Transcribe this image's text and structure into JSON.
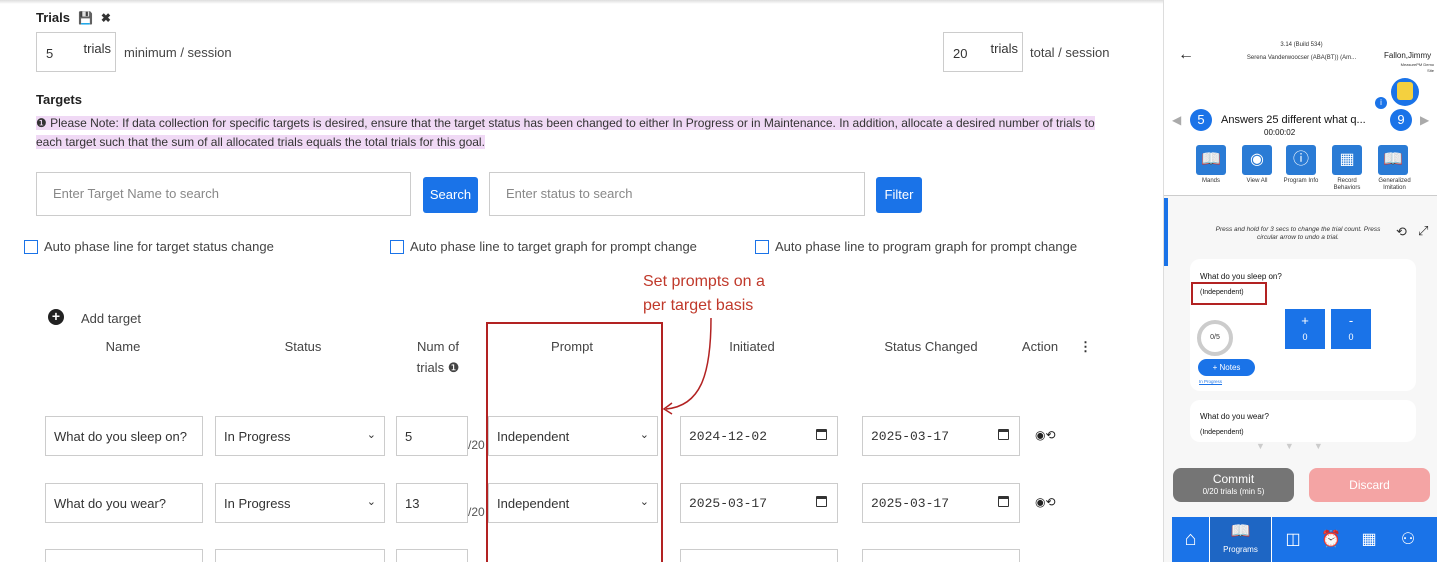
{
  "trials": {
    "title": "Trials",
    "save_icon": "save-icon",
    "close_icon": "close-icon",
    "min_value": "5",
    "min_unit": "trials",
    "min_label": "minimum / session",
    "total_value": "20",
    "total_unit": "trials",
    "total_label": "total / session"
  },
  "targets": {
    "heading": "Targets",
    "note": "Please Note: If data collection for specific targets is desired, ensure that the target status has been changed to either In Progress or in Maintenance. In addition, allocate a desired number of trials to each target such that the sum of all allocated trials equals the total trials for this goal.",
    "search_placeholder": "Enter Target Name to search",
    "search_label": "Search",
    "status_placeholder": "Enter status to search",
    "filter_label": "Filter",
    "checkboxes": [
      "Auto phase line for target status change",
      "Auto phase line to target graph for prompt change",
      "Auto phase line to program graph for prompt change"
    ],
    "add_target": "Add target",
    "columns": {
      "name": "Name",
      "status": "Status",
      "num_trials_1": "Num of",
      "num_trials_2": "trials",
      "prompt": "Prompt",
      "initiated": "Initiated",
      "status_changed": "Status Changed",
      "action": "Action"
    },
    "rows": [
      {
        "name": "What do you sleep on?",
        "status": "In Progress",
        "trials": "5",
        "of": "/20",
        "prompt": "Independent",
        "initiated": "2024-12-02",
        "changed": "2025-03-17"
      },
      {
        "name": "What do you wear?",
        "status": "In Progress",
        "trials": "13",
        "of": "/20",
        "prompt": "Independent",
        "initiated": "2025-03-17",
        "changed": "2025-03-17"
      }
    ]
  },
  "annotation": {
    "line1": "Set prompts on a",
    "line2": "per target basis",
    "color": "#c0392b"
  },
  "mobile": {
    "build": "3.14 (Build 534)",
    "therapist": "Serena Vanderwoocser (ABA(BT)) (Am...",
    "client": "Fallon,Jimmy",
    "site1": "MeasurePM Demo",
    "site2": "Site",
    "left_count": "5",
    "program_title": "Answers 25 different what q...",
    "timer": "00:00:02",
    "right_count": "9",
    "tiles": [
      {
        "icon": "book-icon",
        "label": "Mands"
      },
      {
        "icon": "eye-icon",
        "label": "View All"
      },
      {
        "icon": "info-icon",
        "label": "Program Info"
      },
      {
        "icon": "register-icon",
        "label": "Record Behaviors"
      },
      {
        "icon": "book-icon",
        "label": "Generalized Imitation"
      }
    ],
    "hint": "Press and hold for 3 secs to change the trial count. Press circular arrow to undo a trial.",
    "card1": {
      "question": "What do you sleep on?",
      "prompt": "(Independent)",
      "progress": "0/5",
      "plus": "+",
      "plus_count": "0",
      "minus": "-",
      "minus_count": "0",
      "notes": "+ Notes",
      "status": "In Progress"
    },
    "card2": {
      "question": "What do you wear?",
      "prompt": "(Independent)"
    },
    "commit": "Commit",
    "commit_sub": "0/20 trials (min 5)",
    "discard": "Discard",
    "nav_programs": "Programs",
    "accent": "#1a73e8"
  }
}
